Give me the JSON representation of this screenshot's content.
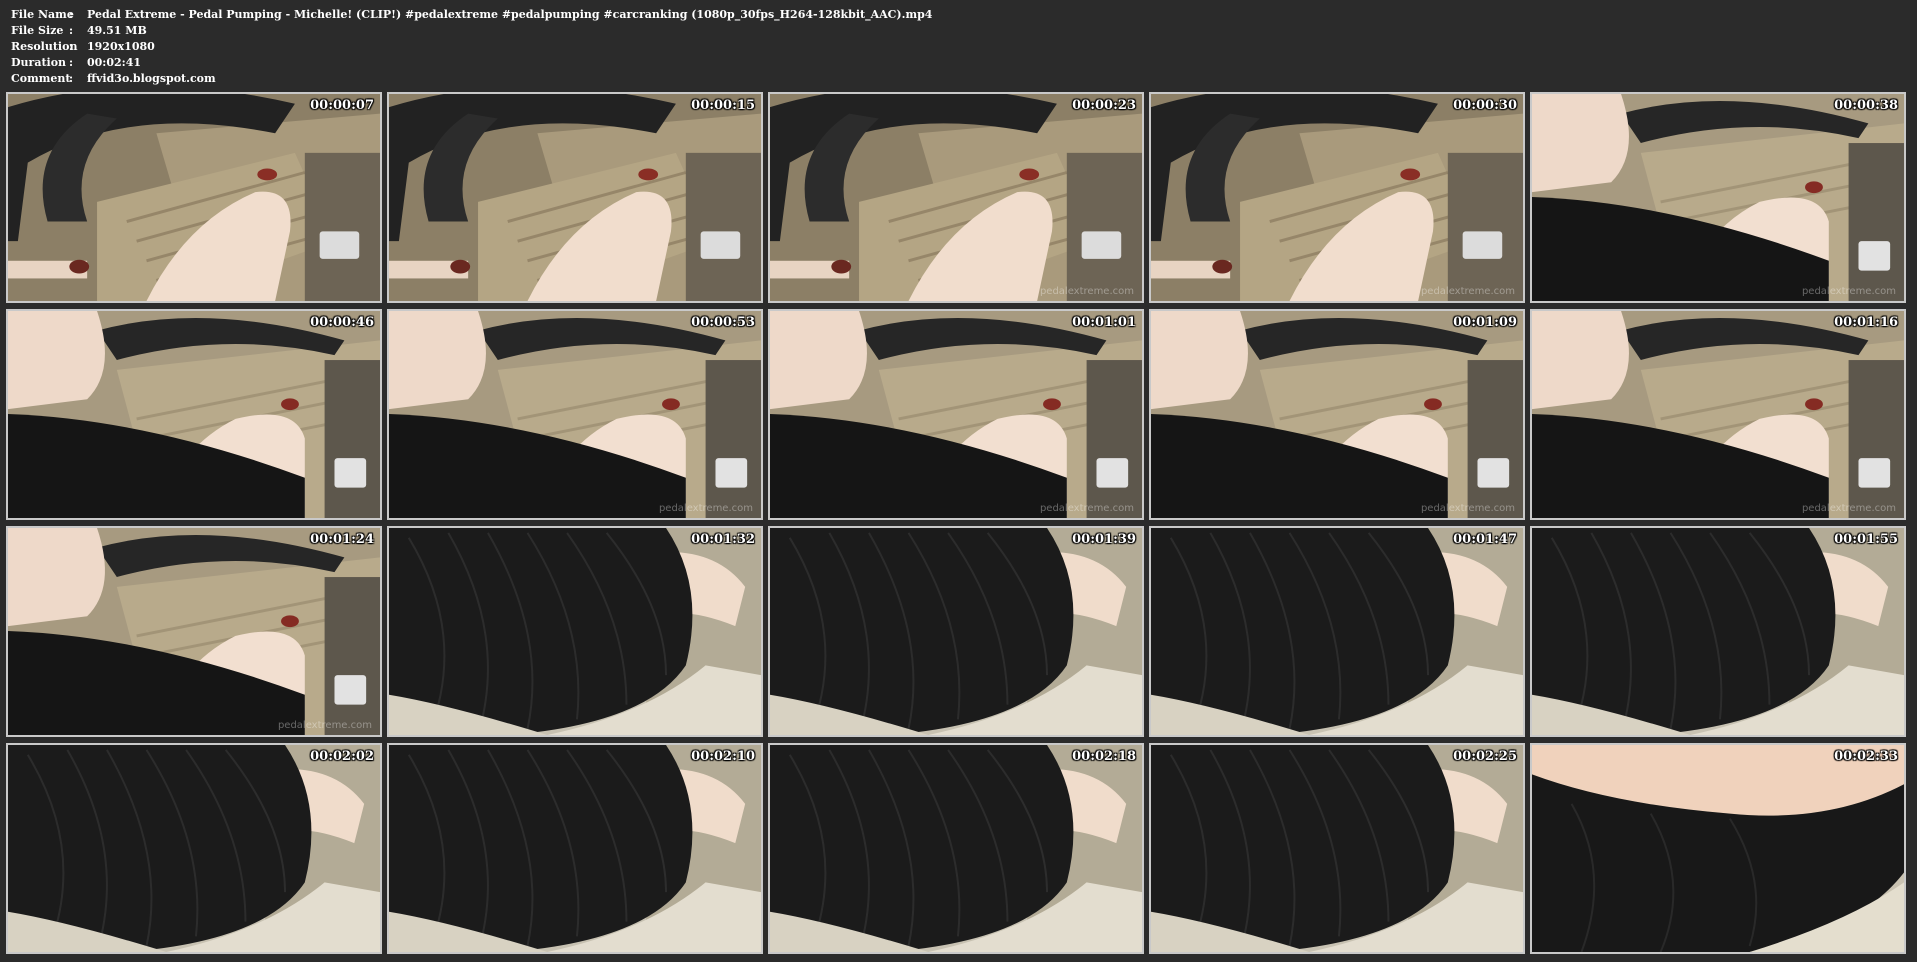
{
  "info": {
    "separator": ":",
    "rows": [
      {
        "label": "File Name",
        "value": "Pedal Extreme - Pedal Pumping - Michelle!  (CLIP!) #pedalextreme #pedalpumping #carcranking (1080p_30fps_H264-128kbit_AAC).mp4"
      },
      {
        "label": "File Size",
        "value": "49.51 MB"
      },
      {
        "label": "Resolution",
        "value": "1920x1080"
      },
      {
        "label": "Duration",
        "value": "00:02:41"
      },
      {
        "label": "Comment",
        "value": "ffvid3o.blogspot.com"
      }
    ]
  },
  "watermark": "pedalextreme.com",
  "thumbnails": [
    {
      "time": "00:00:07",
      "scene": "wheel-pedals",
      "watermark": false
    },
    {
      "time": "00:00:15",
      "scene": "wheel-pedals",
      "watermark": false
    },
    {
      "time": "00:00:23",
      "scene": "wheel-pedals",
      "watermark": true
    },
    {
      "time": "00:00:30",
      "scene": "wheel-pedals",
      "watermark": true
    },
    {
      "time": "00:00:38",
      "scene": "wheel-skirt",
      "watermark": true
    },
    {
      "time": "00:00:46",
      "scene": "wheel-skirt",
      "watermark": false
    },
    {
      "time": "00:00:53",
      "scene": "wheel-skirt",
      "watermark": true
    },
    {
      "time": "00:01:01",
      "scene": "wheel-skirt",
      "watermark": true
    },
    {
      "time": "00:01:09",
      "scene": "wheel-skirt",
      "watermark": true
    },
    {
      "time": "00:01:16",
      "scene": "wheel-skirt",
      "watermark": true
    },
    {
      "time": "00:01:24",
      "scene": "wheel-skirt",
      "watermark": true
    },
    {
      "time": "00:01:32",
      "scene": "skirt-close",
      "watermark": false
    },
    {
      "time": "00:01:39",
      "scene": "skirt-close",
      "watermark": false
    },
    {
      "time": "00:01:47",
      "scene": "skirt-close",
      "watermark": false
    },
    {
      "time": "00:01:55",
      "scene": "skirt-close",
      "watermark": false
    },
    {
      "time": "00:02:02",
      "scene": "skirt-close",
      "watermark": false
    },
    {
      "time": "00:02:10",
      "scene": "skirt-close",
      "watermark": false
    },
    {
      "time": "00:02:18",
      "scene": "skirt-close",
      "watermark": false
    },
    {
      "time": "00:02:25",
      "scene": "skirt-close",
      "watermark": false
    },
    {
      "time": "00:02:33",
      "scene": "skirt-arm",
      "watermark": false
    }
  ],
  "colors": {
    "background": "#2b2b2b",
    "text": "#ffffff",
    "border": "#c9c9c9"
  }
}
